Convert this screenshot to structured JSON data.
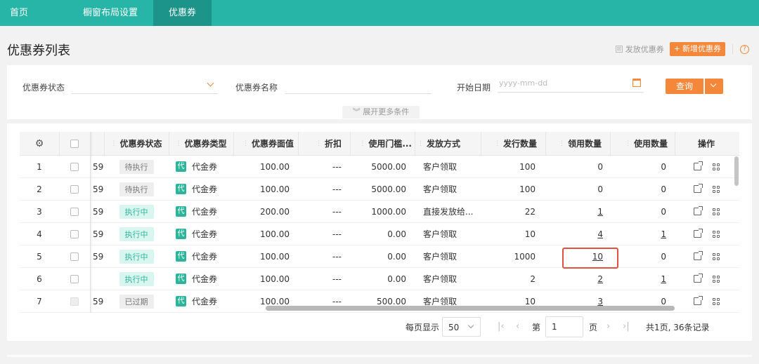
{
  "nav": {
    "home": "首页",
    "window_layout": "橱窗布局设置",
    "coupon": "优惠券"
  },
  "page": {
    "title": "优惠券列表",
    "issue_button": "发放优惠券",
    "new_button": "新增优惠券",
    "help_icon": "?"
  },
  "filters": {
    "status_label": "优惠券状态",
    "name_label": "优惠券名称",
    "start_date_label": "开始日期",
    "start_date_placeholder": "yyyy-mm-dd",
    "query_button": "查询",
    "expand_more": "展开更多条件"
  },
  "table": {
    "columns": [
      "优惠券状态",
      "优惠券类型",
      "优惠券面值",
      "折扣",
      "使用门槛...",
      "发放方式",
      "发行数量",
      "领用数量",
      "使用数量",
      "操作"
    ],
    "rows": [
      {
        "index": "1",
        "frag": "59",
        "status": "待执行",
        "status_style": "gray",
        "type": "代金券",
        "face": "100.00",
        "discount": "---",
        "threshold": "5000.00",
        "method": "客户领取",
        "issued": "100",
        "received": "0",
        "used": "0"
      },
      {
        "index": "2",
        "frag": "59",
        "status": "待执行",
        "status_style": "gray",
        "type": "代金券",
        "face": "100.00",
        "discount": "---",
        "threshold": "5000.00",
        "method": "客户领取",
        "issued": "100",
        "received": "0",
        "used": "0"
      },
      {
        "index": "3",
        "frag": "59",
        "status": "执行中",
        "status_style": "green",
        "type": "代金券",
        "face": "200.00",
        "discount": "---",
        "threshold": "1000.00",
        "method": "直接发放给...",
        "issued": "22",
        "received": "1",
        "used": "0"
      },
      {
        "index": "4",
        "frag": "59",
        "status": "执行中",
        "status_style": "green",
        "type": "代金券",
        "face": "100.00",
        "discount": "---",
        "threshold": "0.00",
        "method": "客户领取",
        "issued": "10",
        "received": "4",
        "used": "1"
      },
      {
        "index": "5",
        "frag": "59",
        "status": "执行中",
        "status_style": "green",
        "type": "代金券",
        "face": "100.00",
        "discount": "---",
        "threshold": "0.00",
        "method": "客户领取",
        "issued": "1000",
        "received": "10",
        "used": "0"
      },
      {
        "index": "6",
        "frag": "",
        "status": "执行中",
        "status_style": "green",
        "type": "代金券",
        "face": "100.00",
        "discount": "---",
        "threshold": "0.00",
        "method": "客户领取",
        "issued": "2",
        "received": "2",
        "used": "1"
      },
      {
        "index": "7",
        "frag": "59",
        "status": "已过期",
        "status_style": "gray",
        "type": "代金券",
        "face": "100.00",
        "discount": "---",
        "threshold": "500.00",
        "method": "客户领取",
        "issued": "10",
        "received": "3",
        "used": "0"
      }
    ],
    "type_icon_char": "代"
  },
  "pager": {
    "per_page_label": "每页显示",
    "per_page_value": "50",
    "page_prefix": "第",
    "page_value": "1",
    "page_suffix": "页",
    "summary": "共1页, 36条记录"
  },
  "colors": {
    "brand": "#26b5a7",
    "accent": "#f5873a",
    "highlight": "#e0533f"
  }
}
